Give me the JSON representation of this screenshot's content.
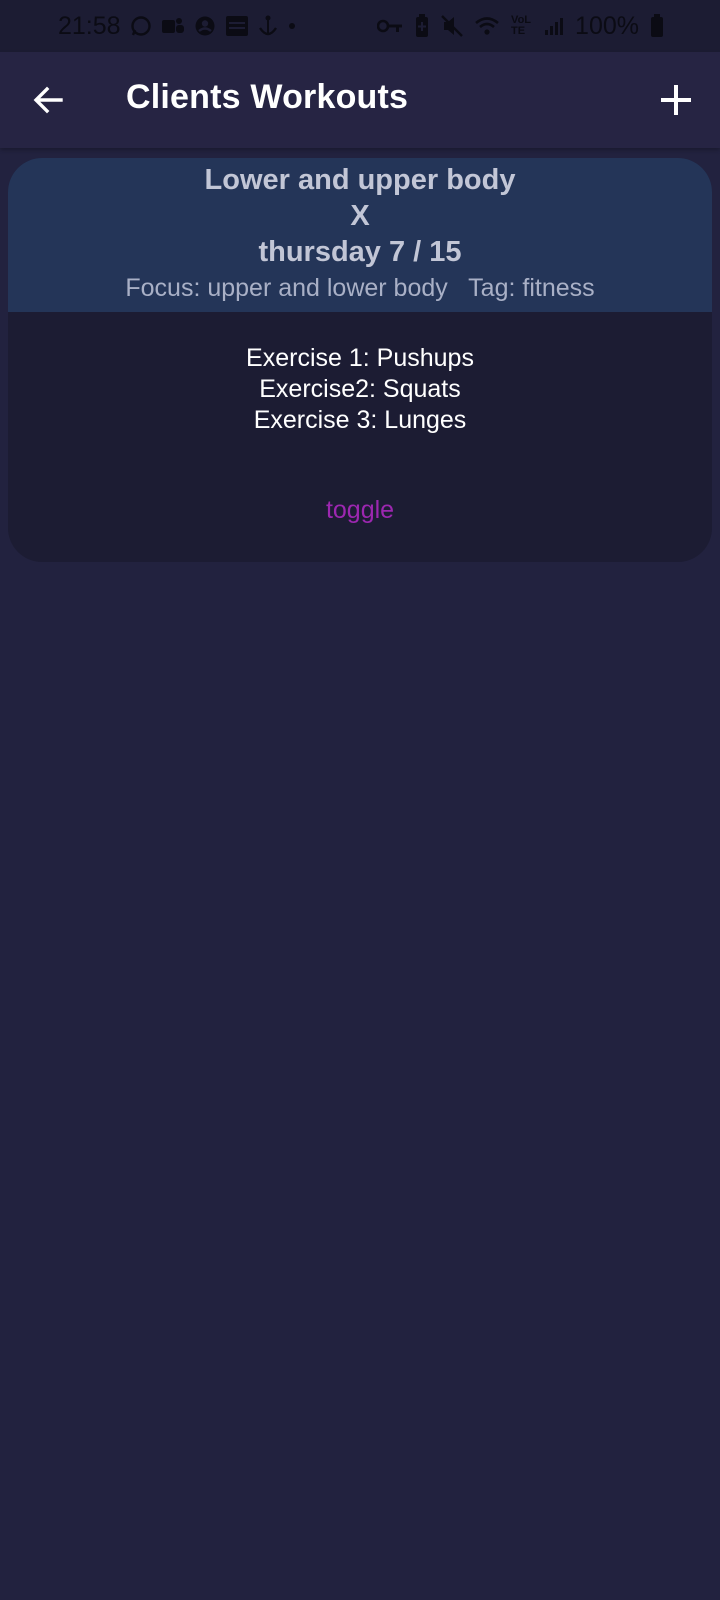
{
  "status_bar": {
    "time": "21:58",
    "battery": "100%",
    "network_label": "VoLTE",
    "left_icons": [
      "whatsapp-icon",
      "teams-icon",
      "account-icon",
      "calendar-icon",
      "anchor-icon",
      "dot-icon"
    ],
    "right_icons": [
      "key-icon",
      "battery-saver-icon",
      "mute-icon",
      "wifi-icon",
      "signal-icon",
      "battery-icon"
    ]
  },
  "app_bar": {
    "title": "Clients Workouts",
    "back_icon": "arrow-back-icon",
    "add_icon": "plus-icon"
  },
  "workout_card": {
    "name": "Lower and upper body",
    "delete_label": "X",
    "date": "thursday 7 / 15",
    "focus": "Focus: upper and lower body",
    "tag": "Tag: fitness",
    "exercises": [
      "Exercise 1: Pushups",
      "Exercise2: Squats",
      "Exercise 3: Lunges"
    ],
    "toggle_label": "toggle"
  },
  "colors": {
    "background": "#22223f",
    "app_bar": "#262443",
    "card_header": "#243558",
    "card_body": "#1c1c33",
    "toggle_accent": "#9c27b0"
  }
}
